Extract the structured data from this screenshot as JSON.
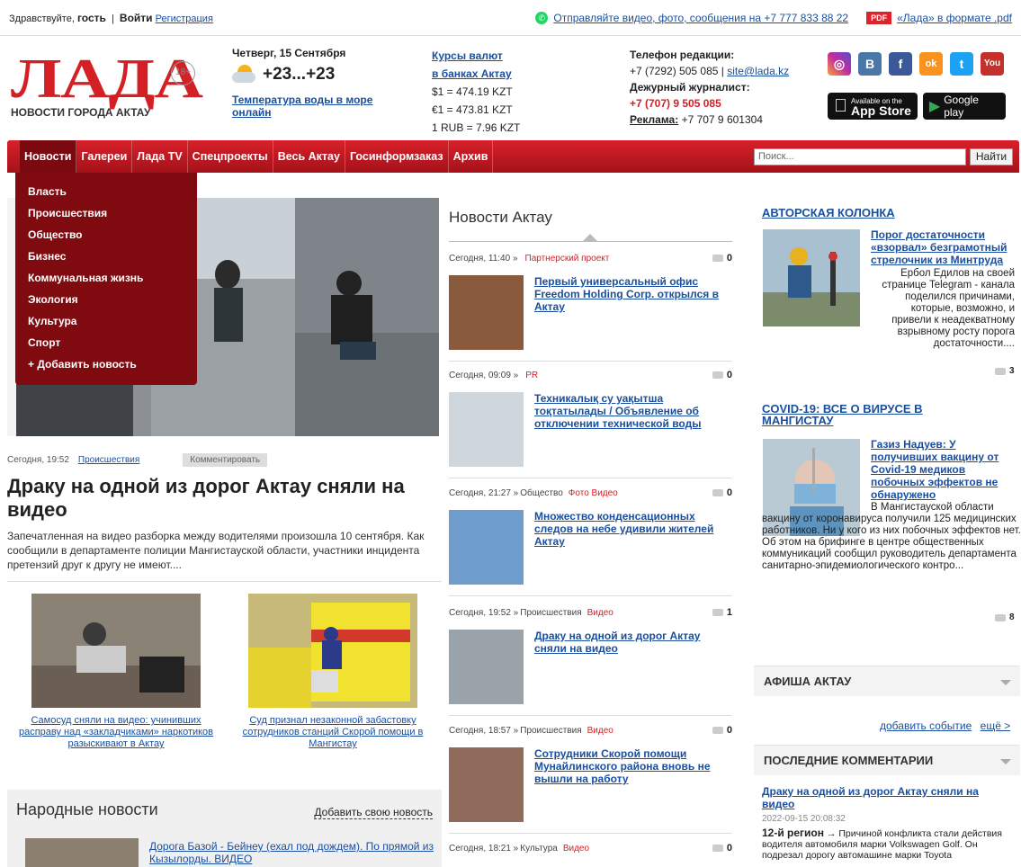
{
  "topbar": {
    "greeting": "Здравствуйте,",
    "guest": "гость",
    "separator": "|",
    "login": "Войти",
    "register": "Регистрация",
    "send_text": "Отправляйте видео, фото, сообщения на +7 777 833 88 22",
    "pdf_badge": "PDF",
    "pdf_link": "«Лада» в формате .pdf"
  },
  "logo": {
    "text": "ЛАДА",
    "age": "18+",
    "subtitle": "НОВОСТИ ГОРОДА АКТАУ"
  },
  "weather": {
    "date": "Четверг, 15 Сентября",
    "temp": "+23...+23",
    "water_link": "Температура воды в море онлайн"
  },
  "rates": {
    "title_line1": "Курсы валют",
    "title_line2": "в банках Актау",
    "usd": "$1 = 474.19 KZT",
    "eur": "€1 = 473.81 KZT",
    "rub": "1 RUB = 7.96 KZT"
  },
  "contacts": {
    "editorial_label": "Телефон редакции:",
    "editorial_phone": "+7 (7292) 505 085 |",
    "email": "site@lada.kz",
    "duty_label": "Дежурный журналист:",
    "duty_phone": "+7 (707) 9 505 085",
    "ads_label": "Реклама:",
    "ads_phone": "+7 707 9 601304"
  },
  "social": {
    "instagram": "◎",
    "vk": "B",
    "facebook": "f",
    "ok": "ok",
    "twitter": "t",
    "youtube": "You"
  },
  "stores": {
    "appstore_small": "Available on the",
    "appstore_big": "App Store",
    "google": "Google play"
  },
  "nav": {
    "items": [
      "Новости",
      "Галереи",
      "Лада TV",
      "Спецпроекты",
      "Весь Актау",
      "Госинформзаказ",
      "Архив"
    ],
    "search_placeholder": "Поиск...",
    "search_button": "Найти"
  },
  "dropdown": [
    "Власть",
    "Происшествия",
    "Общество",
    "Бизнес",
    "Коммунальная жизнь",
    "Экология",
    "Культура",
    "Спорт",
    "+ Добавить новость"
  ],
  "main_story": {
    "time": "Сегодня, 19:52",
    "rubric": "Происшествия",
    "comment_btn": "Комментировать",
    "title": "Драку на одной из дорог Актау сняли на видео",
    "lead": "Запечатленная на видео разборка между водителями произошла 10 сентября. Как сообщили в департаменте полиции Мангистауской области, участники инцидента претензий друг к другу не имеют...."
  },
  "thumbs": [
    {
      "caption": "Самосуд сняли на видео: учинивших расправу над «закладчиками» наркотиков разыскивают в Актау"
    },
    {
      "caption": "Суд признал незаконной забастовку сотрудников станций Скорой помощи в Мангистау"
    }
  ],
  "narod": {
    "title": "Народные новости",
    "add": "Добавить свою новость",
    "first_item": "Дорога Базой - Бейнеу (ехал под дождем). По прямой из Кызылорды. ВИДЕО"
  },
  "middle": {
    "title": "Новости Актау",
    "items": [
      {
        "time": "Сегодня, 11:40 »",
        "rubric": "",
        "tags": "Партнерский проект",
        "count": "0",
        "title": "Первый универсальный офис Freedom Holding Corp. открылся в Актау"
      },
      {
        "time": "Сегодня, 09:09 »",
        "rubric": "",
        "tags": "PR",
        "count": "0",
        "title": "Техникалық су уақытша тоқтатылады / Объявление об отключении технической воды"
      },
      {
        "time": "Сегодня, 21:27 »",
        "rubric": "Общество",
        "tags": "Фото  Видео",
        "count": "0",
        "title": "Множество конденсационных следов на небе удивили жителей Актау"
      },
      {
        "time": "Сегодня, 19:52 »",
        "rubric": "Происшествия",
        "tags": "Видео",
        "count": "1",
        "title": "Драку на одной из дорог Актау сняли на видео"
      },
      {
        "time": "Сегодня, 18:57 »",
        "rubric": "Происшествия",
        "tags": "Видео",
        "count": "0",
        "title": "Сотрудники Скорой помощи Мунайлинского района вновь не вышли на работу"
      },
      {
        "time": "Сегодня, 18:21 »",
        "rubric": "Культура",
        "tags": "Видео",
        "count": "0",
        "title": ""
      }
    ]
  },
  "author_col": {
    "heading": "АВТОРСКАЯ КОЛОНКА",
    "link": "Порог достаточности «взорвал» безграмотный стрелочник из Минтруда",
    "text": "Ербол Едилов на своей странице Telegram - канала поделился причинами, которые, возможно, и привели к неадекватному взрывному росту порога достаточности....",
    "count": "3"
  },
  "covid": {
    "heading": "COVID-19: ВСЕ О ВИРУСЕ В МАНГИСТАУ",
    "link": "Газиз Надуев: У получивших вакцину от Covid-19 медиков побочных эффектов не обнаружено",
    "text": "В Мангистауской области вакцину от коронавируса получили 125 медицинских работников. Ни у кого из них побочных эффектов нет. Об этом на брифинге в центре общественных коммуникаций сообщил руководитель департамента санитарно-эпидемиологического контро...",
    "count": "8"
  },
  "afisha": {
    "heading": "АФИША АКТАУ",
    "add_event": "добавить событие",
    "more": "ещё >"
  },
  "comments": {
    "heading": "ПОСЛЕДНИЕ КОММЕНТАРИИ",
    "link": "Драку на одной из дорог Актау сняли на видео",
    "date": "2022-09-15 20:08:32",
    "author": "12-й регион",
    "arrow": "→",
    "text": "Причиной конфликта стали действия водителя автомобиля марки Volkswagen Golf. Он подрезал дорогу автомашине марки Toyota"
  },
  "colors": {
    "brand_red": "#d41f25",
    "link_blue": "#1a4fa0",
    "dropdown_bg": "#7f0b10"
  }
}
